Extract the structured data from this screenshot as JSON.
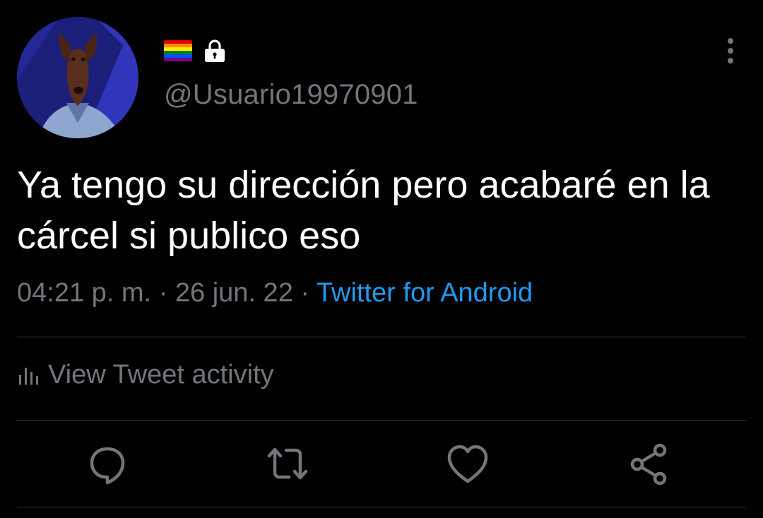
{
  "user": {
    "handle": "@Usuario19970901",
    "badges": [
      "rainbow-flag",
      "lock-icon"
    ]
  },
  "tweet": {
    "text": "Ya tengo su dirección pero acabaré en la cárcel si publico eso",
    "time": "04:21 p. m.",
    "separator": "·",
    "date": "26 jun. 22",
    "source": "Twitter for Android"
  },
  "activity": {
    "label": "View Tweet activity"
  },
  "actions": [
    "reply-icon",
    "retweet-icon",
    "like-icon",
    "share-icon"
  ],
  "colors": {
    "background": "#000000",
    "text": "#ffffff",
    "muted": "#71767b",
    "link": "#1d9bf0",
    "divider": "#2f3336",
    "avatar_bg": "#1a1a66"
  }
}
